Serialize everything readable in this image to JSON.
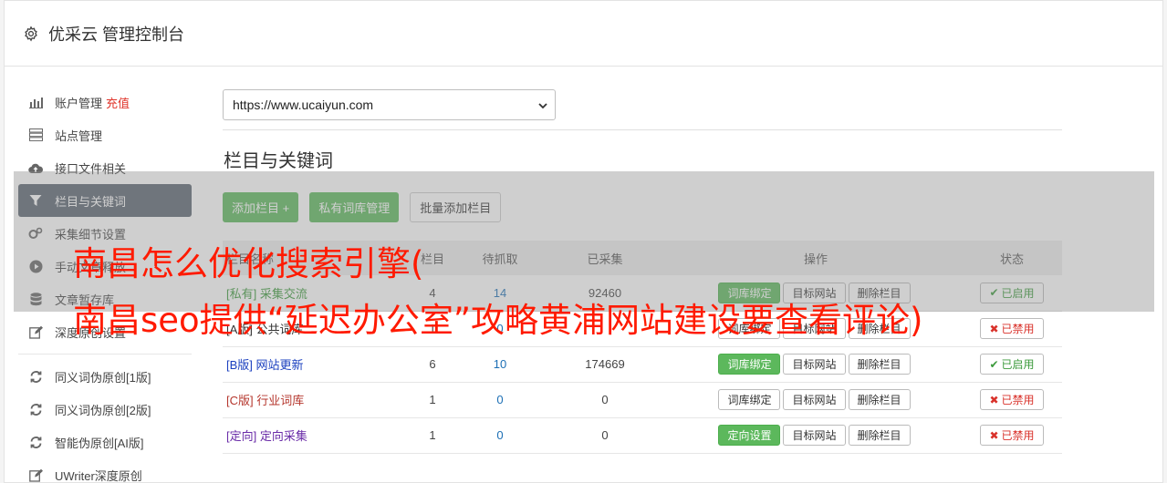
{
  "header": {
    "title": "优采云 管理控制台",
    "icon": "gear-icon"
  },
  "sidebar": {
    "items": [
      {
        "label": "账户管理",
        "extra": "充值",
        "icon": "bar-chart-icon"
      },
      {
        "label": "站点管理",
        "icon": "server-icon"
      },
      {
        "label": "接口文件相关",
        "icon": "cloud-upload-icon"
      },
      {
        "label": "栏目与关键词",
        "icon": "filter-icon"
      },
      {
        "label": "采集细节设置",
        "icon": "cogs-icon"
      },
      {
        "label": "手动文章释放",
        "icon": "play-icon"
      },
      {
        "label": "文章暂存库",
        "icon": "database-icon"
      },
      {
        "label": "深度原创设置",
        "icon": "edit-icon"
      }
    ],
    "items2": [
      {
        "label": "同义词伪原创[1版]",
        "icon": "refresh-icon"
      },
      {
        "label": "同义词伪原创[2版]",
        "icon": "refresh-icon"
      },
      {
        "label": "智能伪原创[AI版]",
        "icon": "refresh-icon"
      },
      {
        "label": "UWriter深度原创",
        "icon": "edit-icon"
      }
    ]
  },
  "main": {
    "site_select": "https://www.ucaiyun.com",
    "section_title": "栏目与关键词",
    "buttons": {
      "add": "添加栏目 +",
      "private": "私有词库管理",
      "batch": "批量添加栏目"
    },
    "table": {
      "headers": [
        "栏目名称",
        "栏目",
        "待抓取",
        "已采集",
        "操作",
        "状态"
      ],
      "rows": [
        {
          "tag": "[私有]",
          "name": "采集交流",
          "col": "4",
          "pending": "14",
          "collected": "92460",
          "op1": "词库绑定",
          "op2": "目标网站",
          "op3": "删除栏目",
          "status": "已启用",
          "tag_color": "#3c9a3c",
          "op1_green": true,
          "on": true
        },
        {
          "tag": "[A版]",
          "name": "公共词库",
          "col": "1",
          "pending": "0",
          "collected": "",
          "op1": "词库绑定",
          "op2": "目标网站",
          "op3": "删除栏目",
          "status": "已禁用",
          "tag_color": "#333333",
          "op1_green": false,
          "on": false
        },
        {
          "tag": "[B版]",
          "name": "网站更新",
          "col": "6",
          "pending": "10",
          "collected": "174669",
          "op1": "词库绑定",
          "op2": "目标网站",
          "op3": "删除栏目",
          "status": "已启用",
          "tag_color": "#1a3fbf",
          "op1_green": true,
          "on": true
        },
        {
          "tag": "[C版]",
          "name": "行业词库",
          "col": "1",
          "pending": "0",
          "collected": "0",
          "op1": "词库绑定",
          "op2": "目标网站",
          "op3": "删除栏目",
          "status": "已禁用",
          "tag_color": "#b5362d",
          "op1_green": false,
          "on": false
        },
        {
          "tag": "[定向]",
          "name": "定向采集",
          "col": "1",
          "pending": "0",
          "collected": "0",
          "op1": "定向设置",
          "op2": "目标网站",
          "op3": "删除栏目",
          "status": "已禁用",
          "tag_color": "#6a2ca8",
          "op1_green": true,
          "on": false
        }
      ]
    }
  },
  "watermark": {
    "line1": "南昌怎么优化搜索引擎(",
    "line2": "南昌seo提供“延迟办公室”攻略黄浦网站建设要查看评论)"
  }
}
